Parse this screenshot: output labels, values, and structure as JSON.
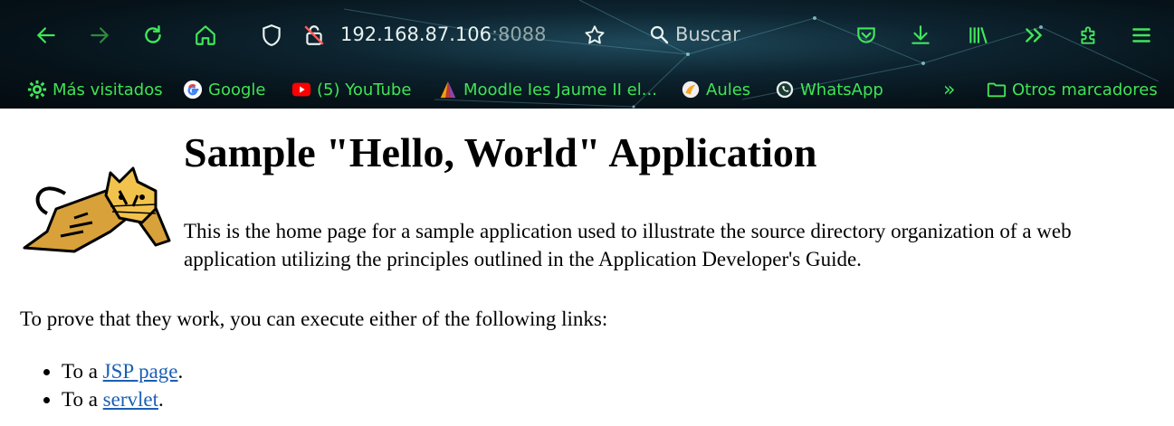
{
  "browser": {
    "url_host": "192.168.87.106",
    "url_port": ":8088",
    "search_placeholder": "Buscar",
    "bookmarks": [
      {
        "label": "Más visitados",
        "icon": "gear-icon"
      },
      {
        "label": "Google",
        "icon": "google-icon"
      },
      {
        "label": "(5) YouTube",
        "icon": "youtube-icon"
      },
      {
        "label": "Moodle Ies Jaume II el...",
        "icon": "moodle-icon"
      },
      {
        "label": "Aules",
        "icon": "aules-icon"
      },
      {
        "label": "WhatsApp",
        "icon": "whatsapp-icon"
      }
    ],
    "more_bookmarks": "»",
    "other_bookmarks": "Otros marcadores"
  },
  "page": {
    "title": "Sample \"Hello, World\" Application",
    "intro": "This is the home page for a sample application used to illustrate the source directory organization of a web application utilizing the principles outlined in the Application Developer's Guide.",
    "prove_text": "To prove that they work, you can execute either of the following links:",
    "links": [
      {
        "prefix": "To a ",
        "label": "JSP page",
        "suffix": "."
      },
      {
        "prefix": "To a ",
        "label": "servlet",
        "suffix": "."
      }
    ]
  },
  "colors": {
    "toolbar_icon": "#40e65a",
    "link": "#1a5fb4"
  }
}
